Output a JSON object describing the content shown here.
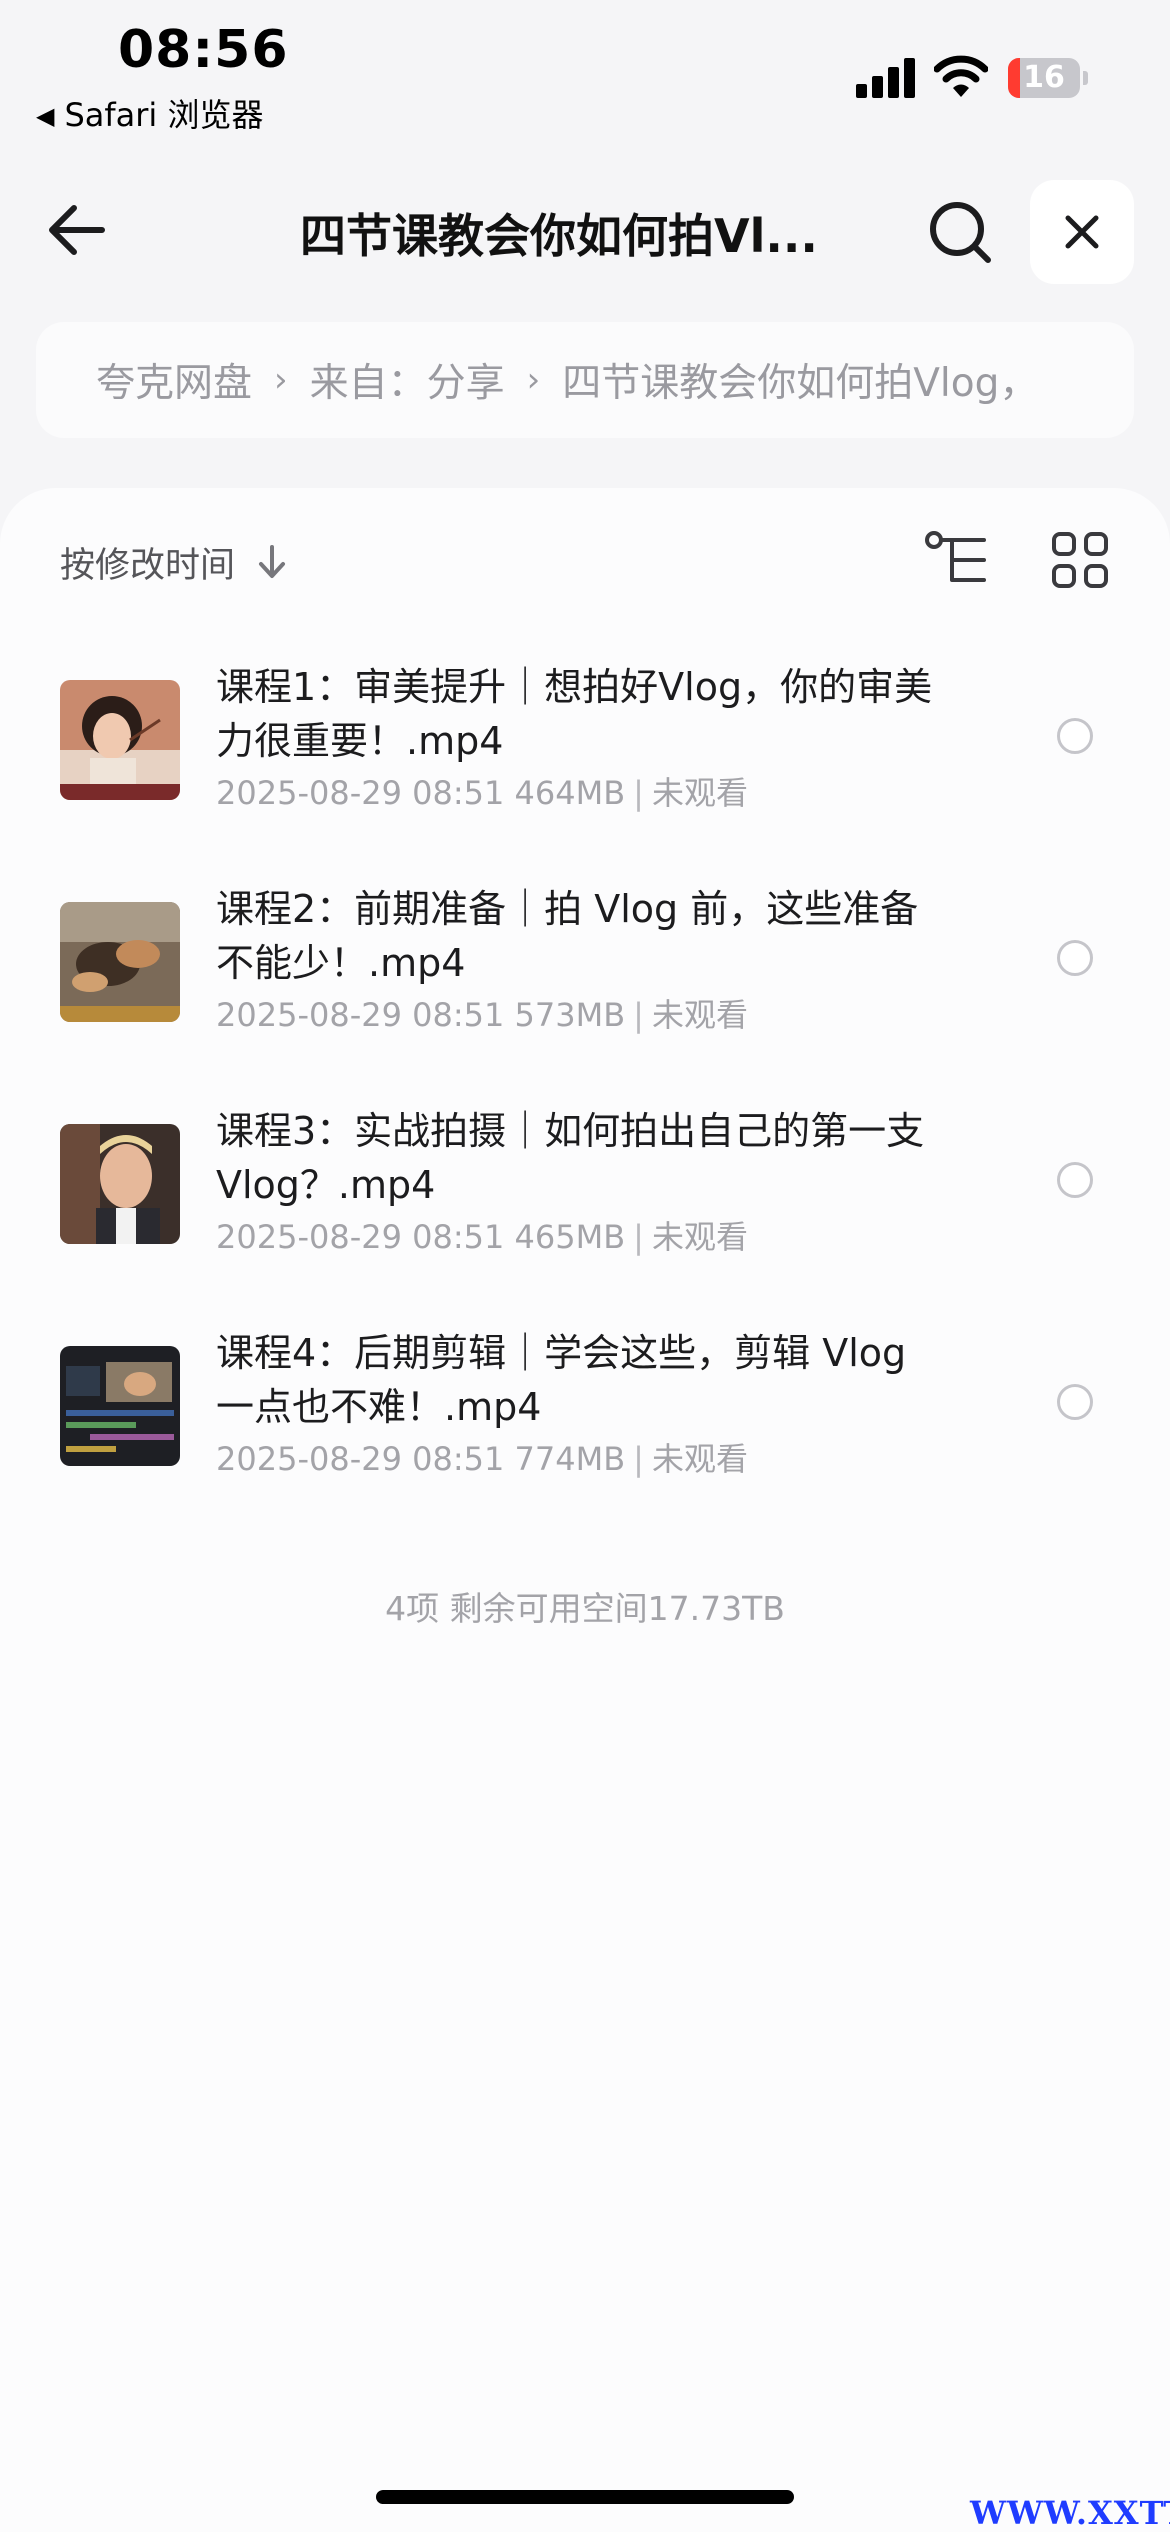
{
  "status_bar": {
    "time": "08:56",
    "back_app": "Safari 浏览器",
    "battery_level": "16",
    "battery_fraction": 0.16
  },
  "nav": {
    "title": "四节课教会你如何拍Vl...",
    "back_icon": "arrow-left-icon",
    "search_icon": "search-icon",
    "close_icon": "close-icon"
  },
  "breadcrumb": {
    "items": [
      "夸克网盘",
      "来自：分享",
      "四节课教会你如何拍Vlog，"
    ],
    "separator": "›"
  },
  "toolbar": {
    "sort_label": "按修改时间",
    "sort_icon": "arrow-down-icon",
    "tree_icon": "tree-view-icon",
    "grid_icon": "grid-view-icon"
  },
  "files": [
    {
      "name": "课程1：审美提升｜想拍好Vlog，你的审美力很重要！.mp4",
      "date": "2025-08-29 08:51",
      "size": "464MB",
      "status": "未观看"
    },
    {
      "name": "课程2：前期准备｜拍 Vlog 前，这些准备不能少！.mp4",
      "date": "2025-08-29 08:51",
      "size": "573MB",
      "status": "未观看"
    },
    {
      "name": "课程3：实战拍摄｜如何拍出自己的第一支 Vlog？.mp4",
      "date": "2025-08-29 08:51",
      "size": "465MB",
      "status": "未观看"
    },
    {
      "name": "课程4：后期剪辑｜学会这些，剪辑 Vlog 一点也不难！.mp4",
      "date": "2025-08-29 08:51",
      "size": "774MB",
      "status": "未观看"
    }
  ],
  "summary": "4项 剩余可用空间17.73TB",
  "watermark": "WWW.XXTTQ.COM",
  "colors": {
    "background": "#f5f5f7",
    "panel": "#fcfcfd",
    "secondary_text": "#a3a3a8",
    "battery_low": "#ff3b30",
    "watermark": "#1f3cff"
  }
}
